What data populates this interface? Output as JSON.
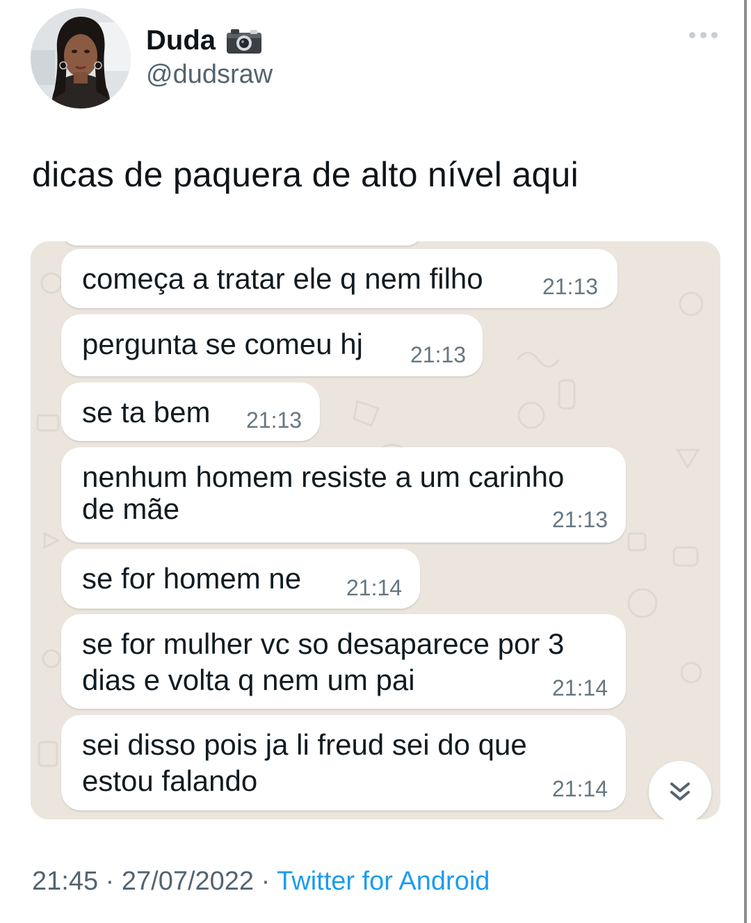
{
  "author": {
    "display_name": "Duda",
    "name_emoji_icon": "camera-icon",
    "handle": "@dudsraw"
  },
  "tweet": {
    "text": "dicas de paquera de alto nível aqui"
  },
  "chat": {
    "messages": [
      {
        "text": "começa a tratar ele q nem filho",
        "time": "21:13"
      },
      {
        "text": "pergunta se comeu hj",
        "time": "21:13"
      },
      {
        "text": "se ta bem",
        "time": "21:13"
      },
      {
        "text_lines": [
          "nenhum homem resiste a um carinho",
          "de mãe"
        ],
        "time": "21:13"
      },
      {
        "text": "se for homem ne",
        "time": "21:14"
      },
      {
        "text_lines": [
          "se for mulher vc so desaparece por 3",
          "dias e volta q nem um pai"
        ],
        "time": "21:14"
      },
      {
        "text_lines": [
          "sei disso pois ja li freud sei do que",
          "estou falando"
        ],
        "time": "21:14"
      }
    ],
    "scroll_button_icon": "double-chevron-down-icon"
  },
  "footer": {
    "time": "21:45",
    "separator": "·",
    "date": "27/07/2022",
    "source": "Twitter for Android"
  },
  "colors": {
    "name": "#0f1419",
    "secondary": "#536471",
    "link": "#1d9bf0",
    "chat_background": "#ece5dd",
    "bubble": "#ffffff"
  }
}
